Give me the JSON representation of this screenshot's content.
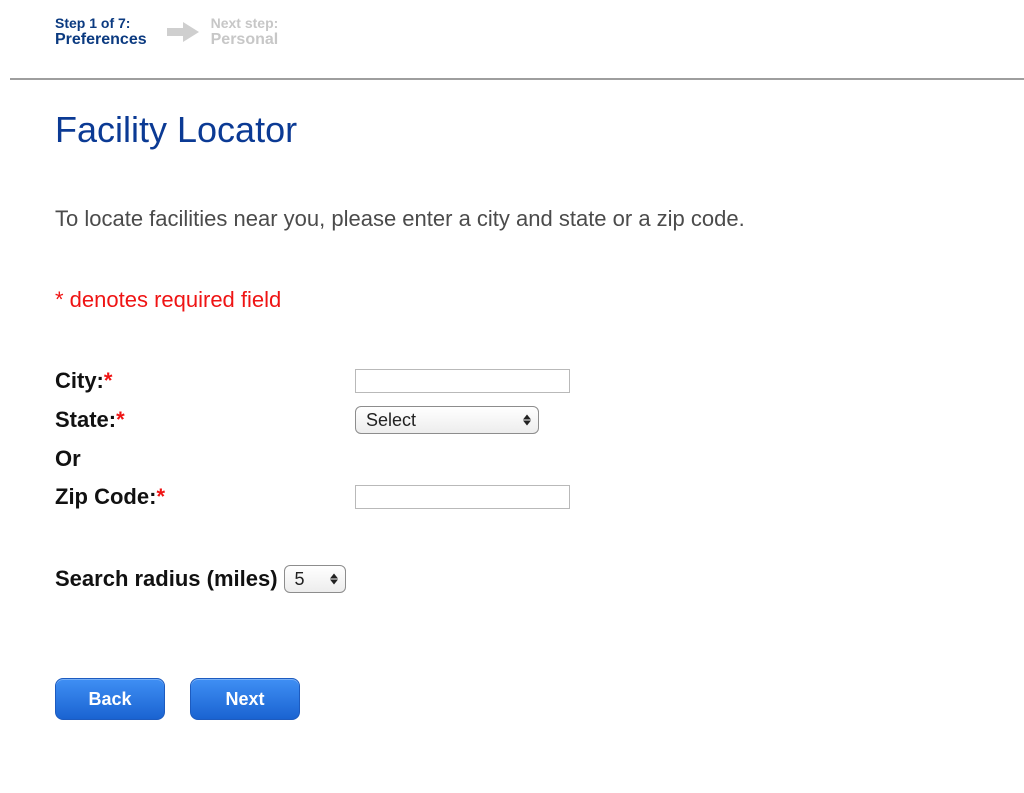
{
  "stepper": {
    "current": {
      "line1": "Step 1 of 7:",
      "line2": "Preferences"
    },
    "next": {
      "line1": "Next step:",
      "line2": "Personal"
    }
  },
  "title": "Facility Locator",
  "instructions": "To locate facilities near you, please enter a city and state or a zip code.",
  "required_note": "* denotes required field",
  "form": {
    "city_label": "City:",
    "state_label": "State:",
    "or_label": "Or",
    "zip_label": "Zip Code:",
    "state_selected": "Select",
    "city_value": "",
    "zip_value": ""
  },
  "radius": {
    "label": "Search radius (miles)",
    "selected": "5"
  },
  "buttons": {
    "back": "Back",
    "next": "Next"
  }
}
